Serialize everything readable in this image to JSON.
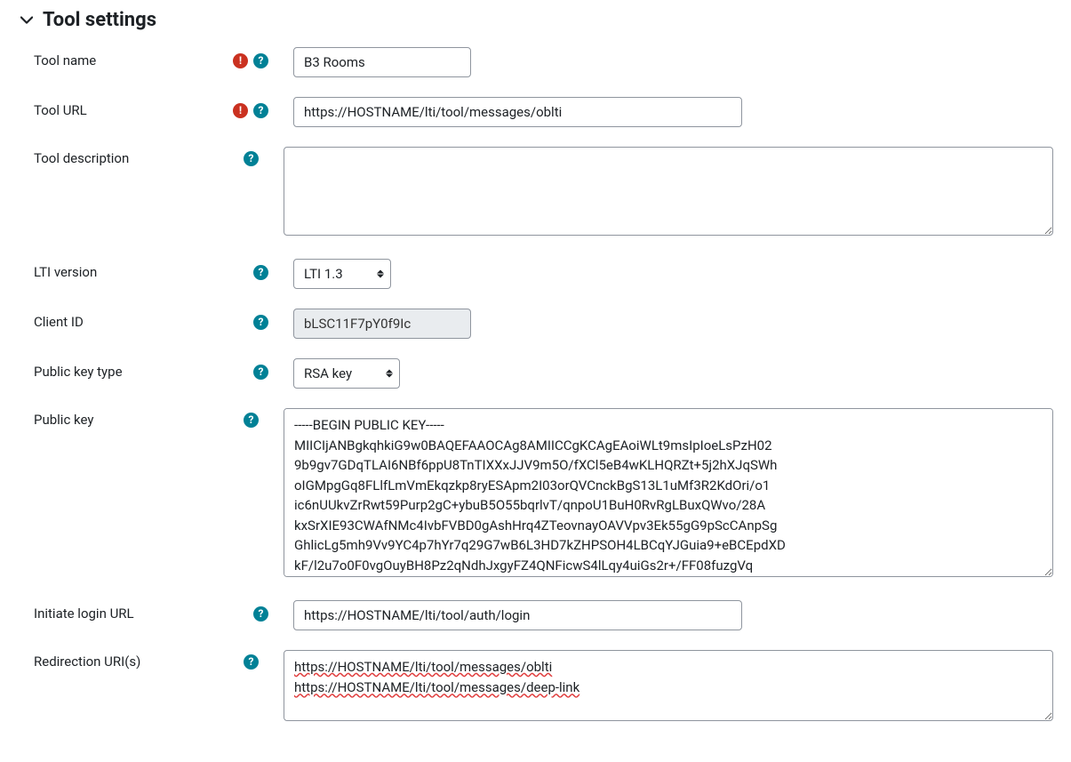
{
  "section_title": "Tool settings",
  "fields": {
    "tool_name": {
      "label": "Tool name",
      "value": "B3 Rooms"
    },
    "tool_url": {
      "label": "Tool URL",
      "value": "https://HOSTNAME/lti/tool/messages/oblti"
    },
    "tool_description": {
      "label": "Tool description",
      "value": ""
    },
    "lti_version": {
      "label": "LTI version",
      "value": "LTI 1.3"
    },
    "client_id": {
      "label": "Client ID",
      "value": "bLSC11F7pY0f9Ic"
    },
    "public_key_type": {
      "label": "Public key type",
      "value": "RSA key"
    },
    "public_key": {
      "label": "Public key",
      "value": "-----BEGIN PUBLIC KEY-----\nMIICIjANBgkqhkiG9w0BAQEFAAOCAg8AMIICCgKCAgEAoiWLt9msIpIoeLsPzH02\n9b9gv7GDqTLAI6NBf6ppU8TnTIXXxJJV9m5O/fXCl5eB4wKLHQRZt+5j2hXJqSWh\noIGMpgGq8FLlfLmVmEkqzkp8ryESApm2I03orQVCnckBgS13L1uMf3R2KdOri/o1\nic6nUUkvZrRwt59Purp2gC+ybuB5O55bqrlvT/qnpoU1BuH0RvRgLBuxQWvo/28A\nkxSrXIE93CWAfNMc4IvbFVBD0gAshHrq4ZTeovnayOAVVpv3Ek55gG9pScCAnpSg\nGhlicLg5mh9Vv9YC4p7hYr7q29G7wB6L3HD7kZHPSOH4LBCqYJGuia9+eBCEpdXD\nkF/l2u7o0F0vgOuyBH8Pz2qNdhJxgyFZ4QNFicwS4lLqy4uiGs2r+/FF08fuzgVq"
    },
    "initiate_login_url": {
      "label": "Initiate login URL",
      "value": "https://HOSTNAME/lti/tool/auth/login"
    },
    "redirection_uris": {
      "label": "Redirection URI(s)",
      "value": "https://HOSTNAME/lti/tool/messages/oblti\nhttps://HOSTNAME/lti/tool/messages/deep-link"
    }
  }
}
